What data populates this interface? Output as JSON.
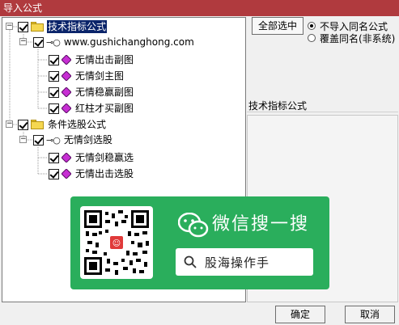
{
  "window": {
    "title": "导入公式"
  },
  "tree": {
    "root1": {
      "label": "技术指标公式",
      "expander": "−"
    },
    "source1": {
      "label": "www.gushichanghong.com",
      "expander": "−"
    },
    "items1": [
      "无情出击副图",
      "无情剑主图",
      "无情稳赢副图",
      "红柱才买副图"
    ],
    "root2": {
      "label": "条件选股公式",
      "expander": "−"
    },
    "source2": {
      "label": "无情剑选股",
      "expander": "−"
    },
    "items2": [
      "无情剑稳赢选",
      "无情出击选股"
    ]
  },
  "controls": {
    "select_all": "全部选中",
    "radio_no_import": "不导入同名公式",
    "radio_overwrite": "覆盖同名(非系统)",
    "info_label": "技术指标公式",
    "ok": "确定",
    "cancel": "取消"
  },
  "overlay": {
    "title": "微信搜一搜",
    "search_text": "股海操作手"
  },
  "colors": {
    "titlebar": "#b03a3e",
    "selection": "#0a246a",
    "overlay_green": "#2aae5c"
  },
  "icons": [
    "folder-icon",
    "key-icon",
    "formula-gem-icon",
    "search-icon",
    "wechat-icon",
    "qr-code"
  ]
}
